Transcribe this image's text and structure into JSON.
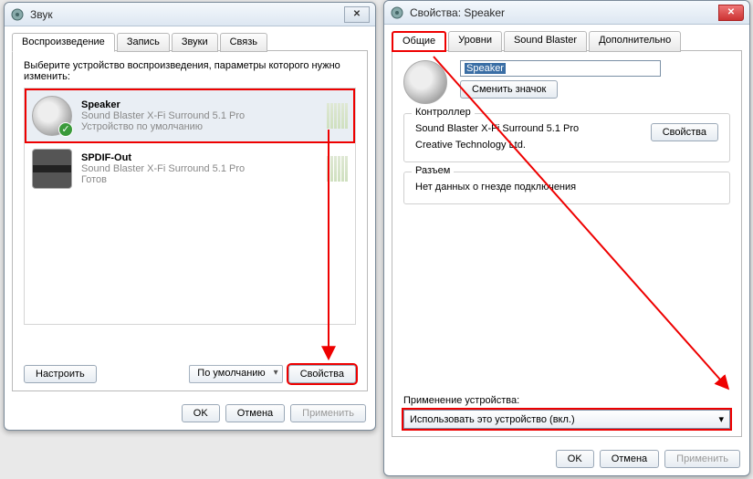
{
  "left": {
    "title": "Звук",
    "tabs": [
      "Воспроизведение",
      "Запись",
      "Звуки",
      "Связь"
    ],
    "instruction": "Выберите устройство воспроизведения, параметры которого нужно изменить:",
    "devices": [
      {
        "name": "Speaker",
        "line2": "Sound Blaster X-Fi Surround 5.1 Pro",
        "line3": "Устройство по умолчанию",
        "default": true,
        "kind": "speaker"
      },
      {
        "name": "SPDIF-Out",
        "line2": "Sound Blaster X-Fi Surround 5.1 Pro",
        "line3": "Готов",
        "default": false,
        "kind": "spdif"
      }
    ],
    "buttons": {
      "configure": "Настроить",
      "default": "По умолчанию",
      "properties": "Свойства",
      "ok": "OK",
      "cancel": "Отмена",
      "apply": "Применить"
    },
    "close_glyph": "✕"
  },
  "right": {
    "title": "Свойства: Speaker",
    "tabs": [
      "Общие",
      "Уровни",
      "Sound Blaster",
      "Дополнительно"
    ],
    "name_value": "Speaker",
    "change_icon": "Сменить значок",
    "controller": {
      "legend": "Контроллер",
      "device": "Sound Blaster X-Fi Surround 5.1 Pro",
      "vendor": "Creative Technology Ltd.",
      "props_btn": "Свойства"
    },
    "jack": {
      "legend": "Разъем",
      "text": "Нет данных о гнезде подключения"
    },
    "usage_label": "Применение устройства:",
    "usage_value": "Использовать это устройство (вкл.)",
    "buttons": {
      "ok": "OK",
      "cancel": "Отмена",
      "apply": "Применить"
    },
    "close_glyph": "✕"
  }
}
